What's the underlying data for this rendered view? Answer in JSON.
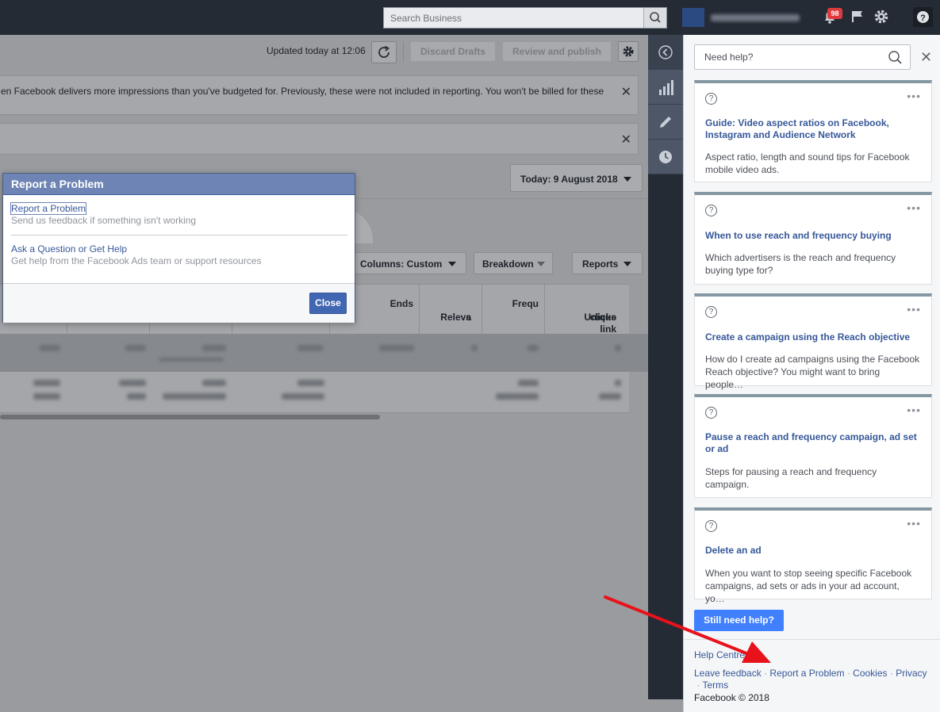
{
  "topbar": {
    "search_placeholder": "Search Business",
    "notification_count": "98"
  },
  "toolbar": {
    "updated_text": "Updated today at 12:06",
    "discard_label": "Discard Drafts",
    "review_label": "Review and publish"
  },
  "banners": {
    "banner1_text": "en Facebook delivers more impressions than you've budgeted for. Previously, these were not included in reporting. You won't be billed for these"
  },
  "date_picker": {
    "label": "Today: 9 August 2018"
  },
  "controls": {
    "columns_label": "Columns: Custom",
    "breakdown_label": "Breakdown",
    "reports_label": "Reports"
  },
  "table": {
    "headers": {
      "ends": "Ends",
      "relevance_1": "Releva",
      "relevance_2": "s",
      "frequency": "Frequ",
      "unique_link_1": "Unique link",
      "unique_link_2": "clicks"
    }
  },
  "dialog": {
    "title": "Report a Problem",
    "option1_title": "Report a Problem",
    "option1_desc": "Send us feedback if something isn't working",
    "option2_title": "Ask a Question or Get Help",
    "option2_desc": "Get help from the Facebook Ads team or support resources",
    "close_label": "Close"
  },
  "help": {
    "search_placeholder": "Need help?",
    "cards": [
      {
        "title": "Guide: Video aspect ratios on Facebook, Instagram and Audience Network",
        "desc": "Aspect ratio, length and sound tips for Facebook mobile video ads."
      },
      {
        "title": "When to use reach and frequency buying",
        "desc": "Which advertisers is the reach and frequency buying type for?"
      },
      {
        "title": "Create a campaign using the Reach objective",
        "desc": "How do I create ad campaigns using the Facebook Reach objective? You might want to bring people…"
      },
      {
        "title": "Pause a reach and frequency campaign, ad set or ad",
        "desc": "Steps for pausing a reach and frequency campaign."
      },
      {
        "title": "Delete an ad",
        "desc": "When you want to stop seeing specific Facebook campaigns, ad sets or ads in your ad account, yo…"
      }
    ],
    "still_need_help": "Still need help?",
    "footer": {
      "help_centre": "Help Centre",
      "leave_feedback": "Leave feedback",
      "report_problem": "Report a Problem",
      "cookies": "Cookies",
      "privacy": "Privacy",
      "terms": "Terms",
      "copyright": "Facebook © 2018"
    }
  },
  "colors": {
    "topbar_bg": "#252b35",
    "dialog_header": "#6d84b4",
    "primary_button": "#4267b2",
    "help_button": "#4080ff",
    "link": "#365899",
    "annotation_arrow": "#e8121b"
  },
  "icons": {
    "search": "search-icon",
    "notifications": "bell-icon",
    "flag": "flag-icon",
    "settings": "gear-icon",
    "help": "question-icon",
    "refresh": "refresh-icon",
    "collapse": "chevron-left-icon",
    "chart": "bar-chart-icon",
    "edit": "pencil-icon",
    "history": "clock-icon"
  }
}
